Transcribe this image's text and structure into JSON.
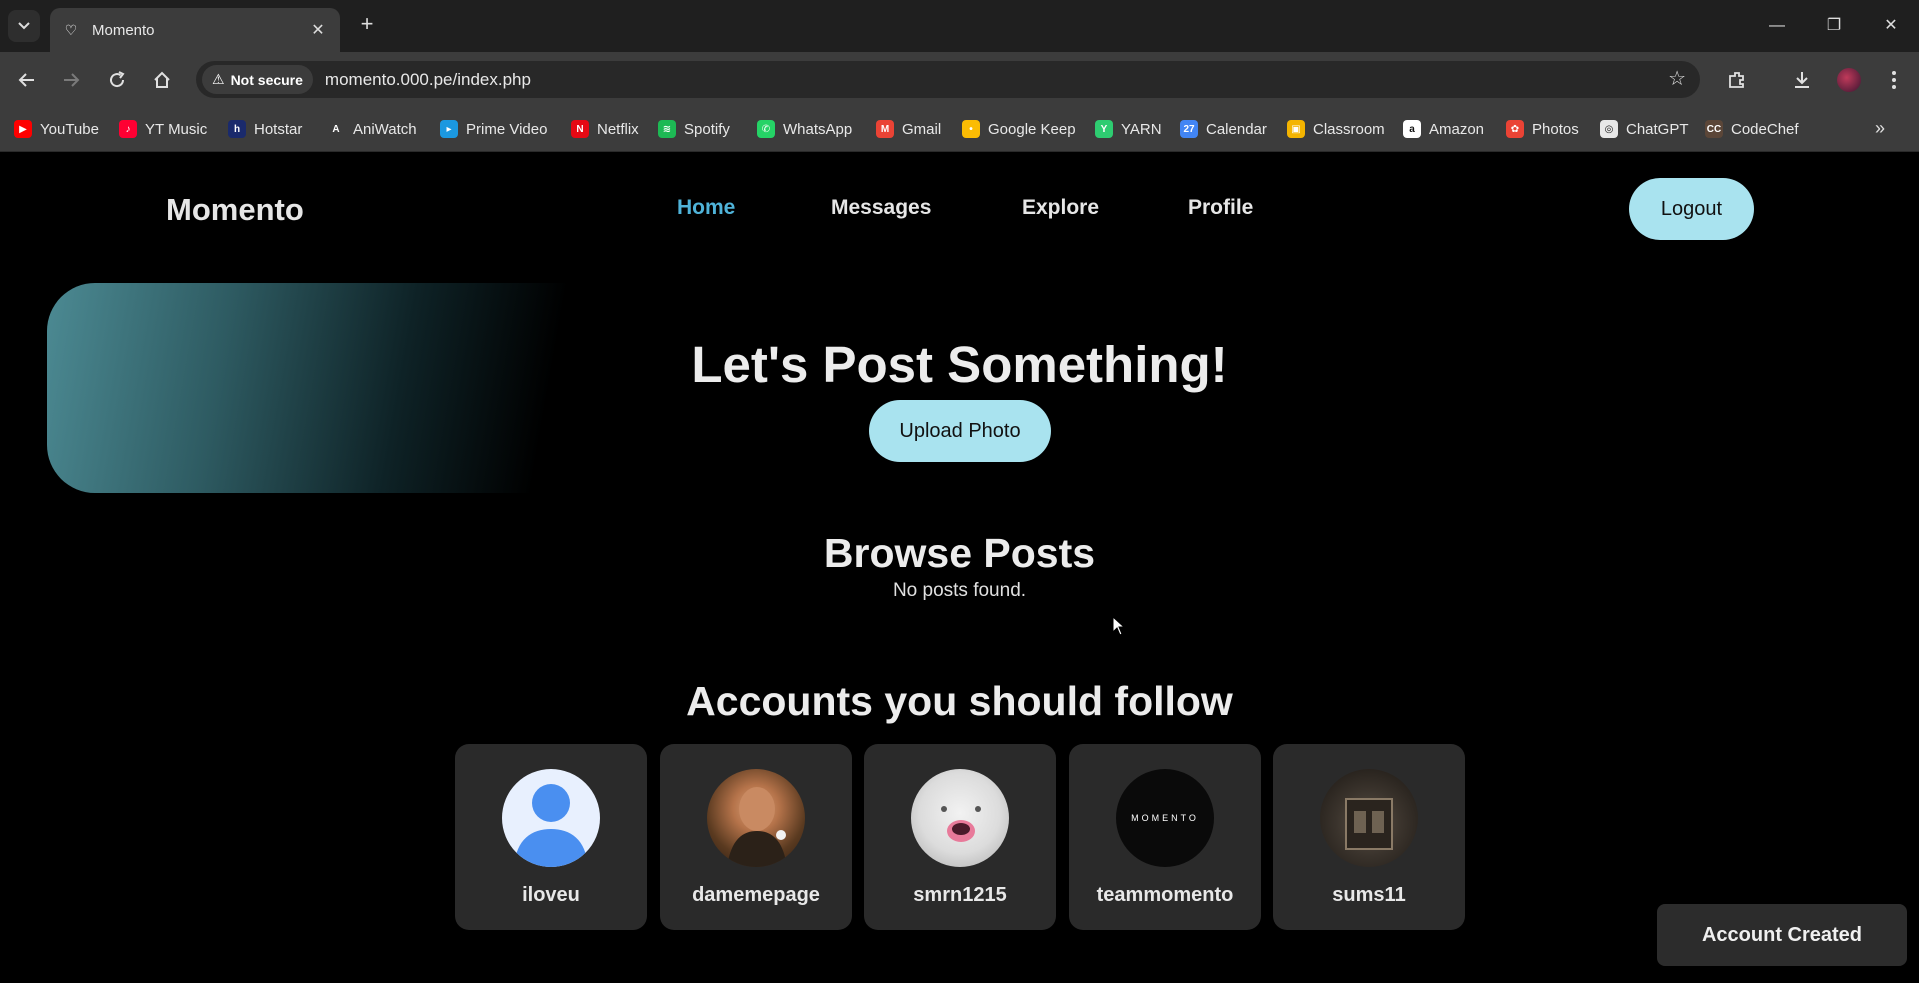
{
  "browser": {
    "tab_title": "Momento",
    "security_label": "Not secure",
    "url": "momento.000.pe/index.php",
    "bookmarks": [
      {
        "label": "YouTube",
        "color": "#ff0000",
        "glyph": "▶"
      },
      {
        "label": "YT Music",
        "color": "#ff0033",
        "glyph": "♪"
      },
      {
        "label": "Hotstar",
        "color": "#1a2a6c",
        "glyph": "h"
      },
      {
        "label": "AniWatch",
        "color": "#3c3c3c",
        "glyph": "A"
      },
      {
        "label": "Prime Video",
        "color": "#1b98e0",
        "glyph": "▸"
      },
      {
        "label": "Netflix",
        "color": "#e50914",
        "glyph": "N"
      },
      {
        "label": "Spotify",
        "color": "#1db954",
        "glyph": "≋"
      },
      {
        "label": "WhatsApp",
        "color": "#25d366",
        "glyph": "✆"
      },
      {
        "label": "Gmail",
        "color": "#ea4335",
        "glyph": "M"
      },
      {
        "label": "Google Keep",
        "color": "#fbbc04",
        "glyph": "•"
      },
      {
        "label": "YARN",
        "color": "#2ecc71",
        "glyph": "Y"
      },
      {
        "label": "Calendar",
        "color": "#4285f4",
        "glyph": "27"
      },
      {
        "label": "Classroom",
        "color": "#f4b400",
        "glyph": "▣"
      },
      {
        "label": "Amazon",
        "color": "#ffffff",
        "glyph": "a"
      },
      {
        "label": "Photos",
        "color": "#ea4335",
        "glyph": "✿"
      },
      {
        "label": "ChatGPT",
        "color": "#e8e8e8",
        "glyph": "◎"
      },
      {
        "label": "CodeChef",
        "color": "#5b4638",
        "glyph": "CC"
      }
    ]
  },
  "site": {
    "brand": "Momento",
    "nav": [
      "Home",
      "Messages",
      "Explore",
      "Profile"
    ],
    "active_nav": "Home",
    "logout_label": "Logout"
  },
  "hero": {
    "title": "Let's Post Something!",
    "upload_label": "Upload Photo"
  },
  "browse": {
    "title": "Browse Posts",
    "empty_text": "No posts found."
  },
  "follow": {
    "title": "Accounts you should follow",
    "accounts": [
      {
        "username": "iloveu"
      },
      {
        "username": "damemepage"
      },
      {
        "username": "smrn1215"
      },
      {
        "username": "teammomento"
      },
      {
        "username": "sums11"
      }
    ]
  },
  "toast": {
    "message": "Account Created"
  },
  "colors": {
    "accent_button": "#a9e3ef",
    "active_link": "#4fb3d9",
    "card_bg": "#2a2a2a"
  }
}
